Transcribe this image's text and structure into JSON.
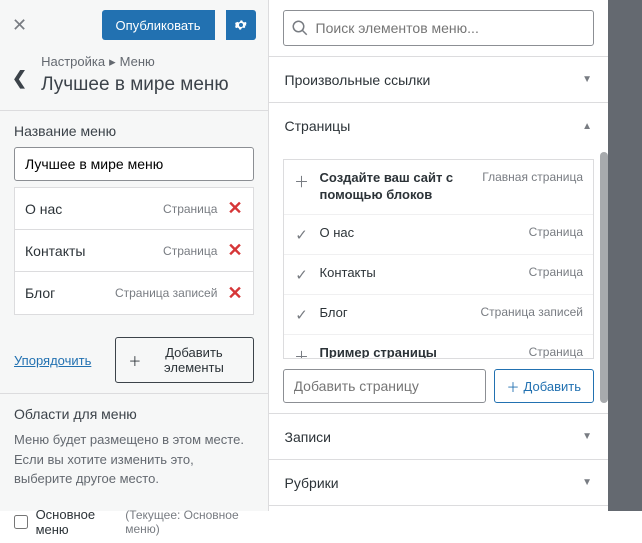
{
  "header": {
    "publish": "Опубликовать"
  },
  "crumb": {
    "a": "Настройка",
    "b": "Меню"
  },
  "title": "Лучшее в мире меню",
  "menu_name_label": "Название меню",
  "menu_name_value": "Лучшее в мире меню",
  "items": [
    {
      "name": "О нас",
      "type": "Страница"
    },
    {
      "name": "Контакты",
      "type": "Страница"
    },
    {
      "name": "Блог",
      "type": "Страница записей"
    }
  ],
  "reorder": "Упорядочить",
  "add_elements": "Добавить элементы",
  "areas": {
    "title": "Области для меню",
    "desc": "Меню будет размещено в этом месте. Если вы хотите изменить это, выберите другое место.",
    "opt": "Основное меню",
    "opt_sub": "(Текущее: Основное меню)"
  },
  "search_placeholder": "Поиск элементов меню...",
  "acc": {
    "links": "Произвольные ссылки",
    "pages": "Страницы",
    "posts": "Записи",
    "cats": "Рубрики"
  },
  "pages": [
    {
      "name": "Создайте ваш сайт с помощью блоков",
      "type": "Главная страница",
      "icon": "add"
    },
    {
      "name": "О нас",
      "type": "Страница",
      "icon": "check"
    },
    {
      "name": "Контакты",
      "type": "Страница",
      "icon": "check"
    },
    {
      "name": "Блог",
      "type": "Страница записей",
      "icon": "check"
    },
    {
      "name": "Пример страницы",
      "type": "Страница",
      "icon": "add"
    }
  ],
  "add_page_placeholder": "Добавить страницу",
  "add_btn": "Добавить"
}
